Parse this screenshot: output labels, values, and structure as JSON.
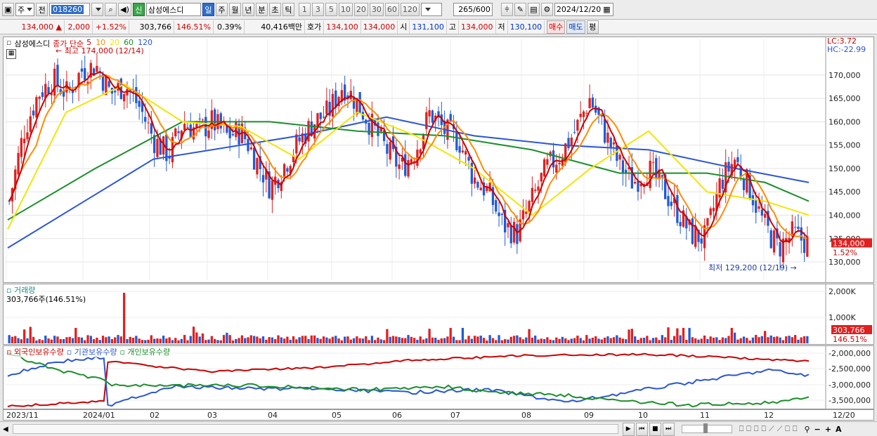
{
  "toolbar": {
    "period_opt": "주",
    "prev": "전",
    "code": "018260",
    "stock_name": "삼성에스디",
    "credit_badge": "신",
    "intervals": [
      "일",
      "주",
      "월",
      "년",
      "분",
      "초",
      "틱"
    ],
    "active_interval": "일",
    "ticks": [
      "1",
      "3",
      "5",
      "10",
      "20",
      "30",
      "60",
      "120"
    ],
    "count": "265",
    "count_total": "/600",
    "date": "2024/12/20"
  },
  "quote": {
    "price": "134,000",
    "arrow": "▲",
    "change": "2,000",
    "change_pct": "+1.52%",
    "volume": "303,766",
    "volume_pct": "146.51%",
    "turnover": "0.39%",
    "amount": "40,416백만",
    "ask_label": "호가",
    "ask": "134,100",
    "bid": "134,000",
    "open_label": "시",
    "open": "131,100",
    "high_label": "고",
    "high": "134,000",
    "low_label": "저",
    "low": "130,100",
    "buy": "매수",
    "sell": "매도",
    "eval": "평"
  },
  "price_panel": {
    "legend_name": "삼성에스디",
    "legend_ma": "종가 단순",
    "ma_periods": [
      "5",
      "10",
      "20",
      "60",
      "120"
    ],
    "ma_colors": [
      "#cc0000",
      "#ff8c00",
      "#f2e600",
      "#1a8f2a",
      "#2a55d6"
    ],
    "lc": "LC:3.72",
    "hc": "HC:-22.99",
    "high_note": "최고 174,000 (12/14)",
    "low_note": "최저 129,200 (12/19)",
    "price_tag": "134,000",
    "pct_tag": "1.52%"
  },
  "volume_panel": {
    "title": "거래량",
    "value": "303,766주(146.51%)",
    "tag": "303,766",
    "tag_pct": "146.51%"
  },
  "holding_panel": {
    "items": [
      "외국인보유수량",
      "기관보유수량",
      "개인보유수량"
    ],
    "colors": [
      "#cc0000",
      "#2a55d6",
      "#1a8f2a"
    ]
  },
  "x_labels": [
    "2023/11",
    "2024/01",
    "02",
    "03",
    "04",
    "05",
    "06",
    "07",
    "08",
    "09",
    "10",
    "11",
    "12",
    "12/20"
  ],
  "chart_data": [
    {
      "type": "candlestick",
      "y_ticks": [
        130000,
        135000,
        140000,
        145000,
        150000,
        155000,
        160000,
        165000,
        170000
      ],
      "y_tick_labels": [
        "130,000",
        "135,000",
        "140,000",
        "145,000",
        "150,000",
        "155,000",
        "160,000",
        "165,000",
        "170,000"
      ],
      "ylim": [
        127000,
        176000
      ],
      "close_path": [
        [
          0,
          143000
        ],
        [
          1,
          158000
        ],
        [
          2,
          166000
        ],
        [
          3,
          169000
        ],
        [
          4,
          166000
        ],
        [
          5,
          171000
        ],
        [
          6,
          172000
        ],
        [
          7,
          166000
        ],
        [
          8,
          168000
        ],
        [
          9,
          163000
        ],
        [
          10,
          156000
        ],
        [
          11,
          153000
        ],
        [
          12,
          160000
        ],
        [
          13,
          158000
        ],
        [
          14,
          160000
        ],
        [
          15,
          157000
        ],
        [
          16,
          158000
        ],
        [
          17,
          152000
        ],
        [
          18,
          146000
        ],
        [
          19,
          151000
        ],
        [
          20,
          156000
        ],
        [
          21,
          160000
        ],
        [
          22,
          162000
        ],
        [
          23,
          168000
        ],
        [
          24,
          164000
        ],
        [
          25,
          159000
        ],
        [
          26,
          154000
        ],
        [
          27,
          150000
        ],
        [
          28,
          154000
        ],
        [
          29,
          162000
        ],
        [
          30,
          158000
        ],
        [
          31,
          156000
        ],
        [
          32,
          148000
        ],
        [
          33,
          145000
        ],
        [
          34,
          138000
        ],
        [
          35,
          136000
        ],
        [
          36,
          143000
        ],
        [
          37,
          150000
        ],
        [
          38,
          153000
        ],
        [
          39,
          158000
        ],
        [
          40,
          165000
        ],
        [
          41,
          158000
        ],
        [
          42,
          151000
        ],
        [
          43,
          147000
        ],
        [
          44,
          150000
        ],
        [
          45,
          146000
        ],
        [
          46,
          141000
        ],
        [
          47,
          136000
        ],
        [
          48,
          135000
        ],
        [
          49,
          147000
        ],
        [
          50,
          152000
        ],
        [
          51,
          146000
        ],
        [
          52,
          138000
        ],
        [
          53,
          133000
        ],
        [
          54,
          136000
        ],
        [
          55,
          134000
        ]
      ],
      "ma_paths": {
        "ma20": [
          [
            0,
            137000
          ],
          [
            4,
            162000
          ],
          [
            8,
            168000
          ],
          [
            12,
            160000
          ],
          [
            16,
            159000
          ],
          [
            20,
            152000
          ],
          [
            24,
            162000
          ],
          [
            28,
            157000
          ],
          [
            32,
            150000
          ],
          [
            36,
            140000
          ],
          [
            40,
            150000
          ],
          [
            44,
            158000
          ],
          [
            48,
            145000
          ],
          [
            52,
            143000
          ],
          [
            55,
            140000
          ]
        ],
        "ma60": [
          [
            0,
            139000
          ],
          [
            6,
            150000
          ],
          [
            12,
            160000
          ],
          [
            18,
            160000
          ],
          [
            24,
            158000
          ],
          [
            30,
            157000
          ],
          [
            36,
            154000
          ],
          [
            42,
            149000
          ],
          [
            48,
            149000
          ],
          [
            52,
            147000
          ],
          [
            55,
            143000
          ]
        ],
        "ma120": [
          [
            0,
            133000
          ],
          [
            10,
            152000
          ],
          [
            20,
            157000
          ],
          [
            26,
            161000
          ],
          [
            32,
            157000
          ],
          [
            38,
            155000
          ],
          [
            44,
            154000
          ],
          [
            50,
            150000
          ],
          [
            55,
            147000
          ]
        ]
      }
    },
    {
      "type": "bar",
      "name": "거래량",
      "y_tick_labels": [
        "2,000K",
        "1,000K"
      ],
      "ylim": [
        0,
        2000000
      ]
    },
    {
      "type": "line",
      "name": "보유수량",
      "y_tick_labels": [
        "-2,000,000",
        "-2,500,000",
        "-3,000,000",
        "-3,500,000"
      ],
      "ylim": [
        -3700000,
        -1900000
      ]
    }
  ],
  "bottom": {
    "nav": [
      "▶",
      "⏮",
      "■",
      "⏭"
    ],
    "zoom_out": "−",
    "zoom_in": "+",
    "auto": "A"
  }
}
